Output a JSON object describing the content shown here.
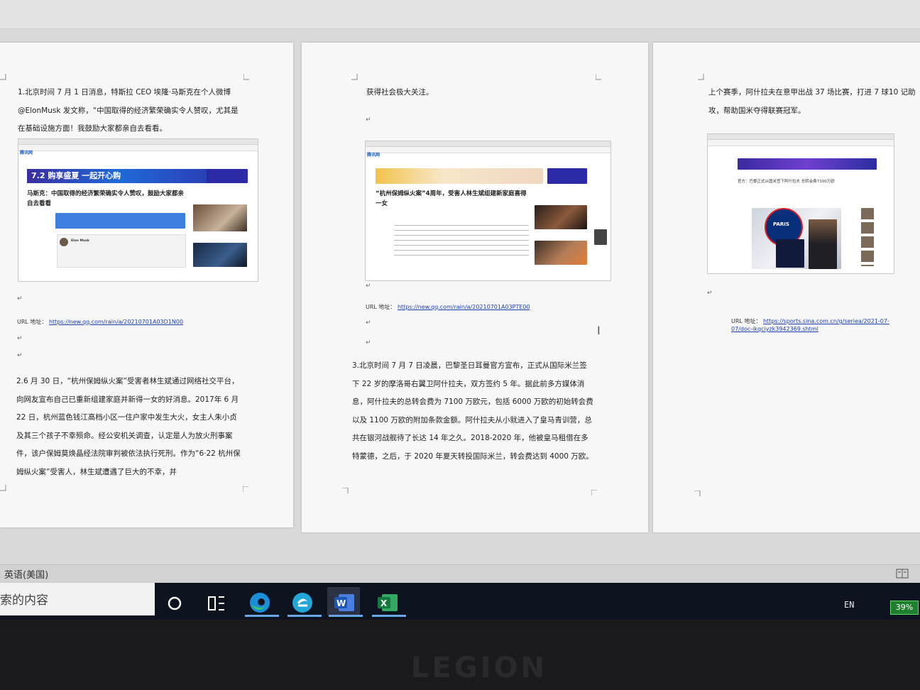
{
  "page1": {
    "para1": "1.北京时间 7 月 1 日消息，特斯拉 CEO 埃隆·马斯克在个人微博@ElonMusk 发文称，“中国取得的经济繁荣确实令人赞叹，尤其是在基础设施方面！我鼓励大家都亲自去看看。",
    "thumb": {
      "brand": "腾讯网",
      "banner": "7.2 购享盛夏 一起开心购",
      "headline": "马斯克：中国取得的经济繁荣确实令人赞叹，鼓励大家都亲自去看看",
      "tweet_user": "Elon Musk"
    },
    "url_label": "URL 地址：",
    "url": "https://new.qq.com/rain/a/20210701A03D1N00",
    "para2": "2.6 月 30 日，“杭州保姆纵火案”受害者林生斌通过网络社交平台，向网友宣布自己已重新组建家庭并新得一女的好消息。2017年 6 月 22 日，杭州蓝色钱江高档小区一住户家中发生大火，女主人朱小贞及其三个孩子不幸殒命。经公安机关调查，认定是人为放火刑事案件，该户保姆莫焕晶经法院审判被依法执行死刑。作为“6·22 杭州保姆纵火案”受害人，林生斌遭遇了巨大的不幸，并"
  },
  "page2": {
    "para1": "获得社会极大关注。",
    "thumb": {
      "brand": "腾讯网",
      "headline": "“杭州保姆纵火案”4周年，受害人林生斌组建新家庭喜得一女"
    },
    "url_label": "URL 地址：",
    "url": "https://new.qq.com/rain/a/20210701A03PTE00",
    "para2": "3.北京时间 7 月 7 日凌晨，巴黎圣日耳曼官方宣布，正式从国际米兰签下 22 岁的摩洛哥右翼卫阿什拉夫，双方签约 5 年。据此前多方媒体消息，阿什拉夫的总转会费为 7100 万欧元，包括 6000 万欧的初始转会费以及 1100 万欧的附加条款金额。阿什拉夫从小就进入了皇马青训营，总共在银河战舰待了长达 14 年之久。2018-2020 年，他被皇马租借在多特蒙德，之后，于 2020 年夏天转投国际米兰，转会费达到 4000 万欧。"
  },
  "page3": {
    "para1": "上个赛季，阿什拉夫在意甲出战 37 场比赛，打进 7 球10 记助攻，帮助国米夺得联赛冠军。",
    "thumb": {
      "headline": "官方：巴黎正式从国米签下阿什拉夫 总转会费7100万欧",
      "club": "PARIS"
    },
    "url_label": "URL 地址：",
    "url": "https://sports.sina.com.cn/g/seriea/2021-07-07/doc-ikqciyzk3942369.shtml"
  },
  "status_bar": {
    "language": "英语(美国)"
  },
  "taskbar": {
    "search_text": "索的内容",
    "apps": [
      "cortana",
      "task-view",
      "edge",
      "360-browser",
      "word",
      "excel"
    ],
    "tray_lang": "EN",
    "battery": "39%"
  },
  "bezel": {
    "logo": "LEGION"
  }
}
